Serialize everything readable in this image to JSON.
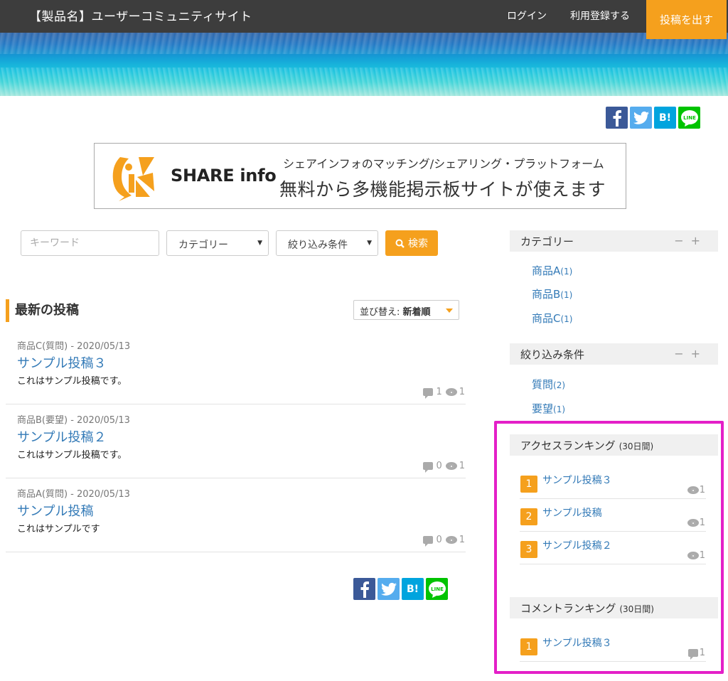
{
  "header": {
    "site_title": "【製品名】ユーザーコミュニティサイト",
    "login": "ログイン",
    "register": "利用登録する",
    "post_button": "投稿を出す"
  },
  "social": {
    "facebook": "f",
    "twitter": "twitter-bird-icon",
    "hatena": "B!",
    "line": "LINE"
  },
  "banner": {
    "brand": "SHARE info",
    "subtitle": "シェアインフォのマッチング/シェアリング・プラットフォーム",
    "headline": "無料から多機能掲示板サイトが使えます",
    "logo_color": "#f5a01d"
  },
  "search": {
    "keyword_placeholder": "キーワード",
    "category_select": "カテゴリー",
    "filter_select": "絞り込み条件",
    "button": "検索"
  },
  "main": {
    "section_title": "最新の投稿",
    "sort_label": "並び替え:",
    "sort_value": "新着順",
    "posts": [
      {
        "meta": "商品C(質問) - 2020/05/13",
        "title": "サンプル投稿３",
        "excerpt": "これはサンプル投稿です。",
        "comments": "1",
        "views": "1"
      },
      {
        "meta": "商品B(要望) - 2020/05/13",
        "title": "サンプル投稿２",
        "excerpt": "これはサンプル投稿です。",
        "comments": "0",
        "views": "1"
      },
      {
        "meta": "商品A(質問) - 2020/05/13",
        "title": "サンプル投稿",
        "excerpt": "これはサンプルです",
        "comments": "0",
        "views": "1"
      }
    ]
  },
  "sidebar": {
    "categories": {
      "heading": "カテゴリー",
      "items": [
        {
          "label": "商品A",
          "count": "(1)"
        },
        {
          "label": "商品B",
          "count": "(1)"
        },
        {
          "label": "商品C",
          "count": "(1)"
        }
      ]
    },
    "filters": {
      "heading": "絞り込み条件",
      "items": [
        {
          "label": "質問",
          "count": "(2)"
        },
        {
          "label": "要望",
          "count": "(1)"
        }
      ]
    },
    "access_ranking": {
      "heading": "アクセスランキング",
      "period": "(30日間)",
      "items": [
        {
          "rank": "1",
          "title": "サンプル投稿３",
          "views": "1"
        },
        {
          "rank": "2",
          "title": "サンプル投稿",
          "views": "1"
        },
        {
          "rank": "3",
          "title": "サンプル投稿２",
          "views": "1"
        }
      ]
    },
    "comment_ranking": {
      "heading": "コメントランキング",
      "period": "(30日間)",
      "items": [
        {
          "rank": "1",
          "title": "サンプル投稿３",
          "comments": "1"
        }
      ]
    },
    "ctrl_minus": "−",
    "ctrl_plus": "+"
  },
  "colors": {
    "accent": "#f5a01d",
    "header_bg": "#3d3d3d",
    "link": "#337ab7",
    "highlight": "#e41fc8"
  }
}
